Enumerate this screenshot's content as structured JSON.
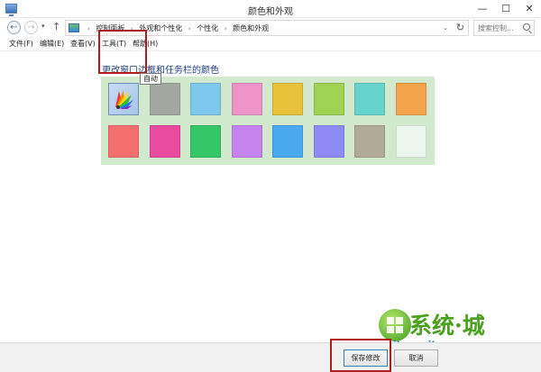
{
  "window": {
    "title": "颜色和外观",
    "minimize": "—",
    "maximize": "☐",
    "close": "✕"
  },
  "nav": {
    "back": "←",
    "forward": "→",
    "dropdown": "▾",
    "up": "↑"
  },
  "address": {
    "crumbs": [
      "控制面板",
      "外观和个性化",
      "个性化",
      "颜色和外观"
    ],
    "separator": "›",
    "dropdown": "⌄",
    "refresh": "↻"
  },
  "search": {
    "placeholder": "搜索控制..."
  },
  "menu": [
    "文件(F)",
    "编辑(E)",
    "查看(V)",
    "工具(T)",
    "帮助(H)"
  ],
  "page": {
    "heading": "更改窗口边框和任务栏的颜色"
  },
  "swatches": {
    "row1": [
      "auto",
      "#a3a8a0",
      "#7ec8ee",
      "#ec93c9",
      "#e6c33a",
      "#a0d256",
      "#66d4cd",
      "#f3a34b"
    ],
    "row2": [
      "#f4706e",
      "#e94b9f",
      "#35c767",
      "#c483ed",
      "#4aa9ee",
      "#8e8cf4",
      "#b2aa99",
      "#eef7ee"
    ]
  },
  "tooltip": "自动",
  "buttons": {
    "save": "保存修改",
    "cancel": "取消"
  },
  "watermark": {
    "name": "系统·城",
    "url": "xitongcity.com"
  }
}
